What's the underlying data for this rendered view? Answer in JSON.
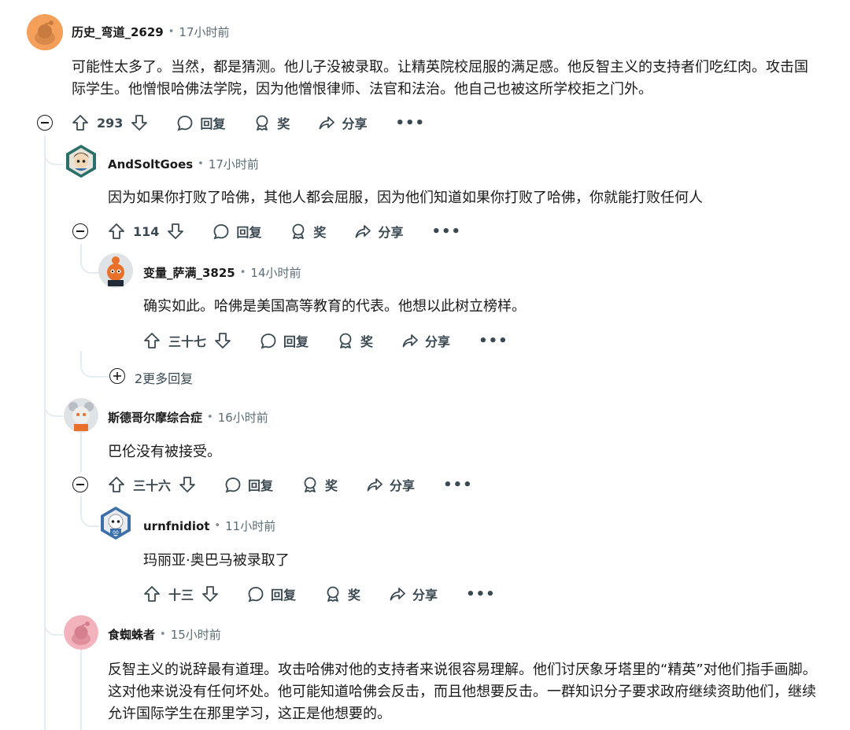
{
  "comments": [
    {
      "username": "历史_弯道_2629",
      "time": "17小时前",
      "text": "可能性太多了。当然，都是猜测。他儿子没被录取。让精英院校屈服的满足感。他反智主义的支持者们吃红肉。攻击国际学生。他憎恨哈佛法学院，因为他憎恨律师、法官和法治。他自己也被这所学校拒之门外。",
      "votes": "293"
    },
    {
      "username": "AndSoltGoes",
      "time": "17小时前",
      "text": "因为如果你打败了哈佛，其他人都会屈服，因为他们知道如果你打败了哈佛，你就能打败任何人",
      "votes": "114"
    },
    {
      "username": "变量_萨满_3825",
      "time": "14小时前",
      "text": "确实如此。哈佛是美国高等教育的代表。他想以此树立榜样。",
      "votes": "三十七"
    },
    {
      "username": "斯德哥尔摩综合症",
      "time": "16小时前",
      "text": "巴伦没有被接受。",
      "votes": "三十六"
    },
    {
      "username": "urnfnidiot",
      "time": "11小时前",
      "text": "玛丽亚·奥巴马被录取了",
      "votes": "十三"
    },
    {
      "username": "食蜘蛛者",
      "time": "15小时前",
      "text": "反智主义的说辞最有道理。攻击哈佛对他的支持者来说很容易理解。他们讨厌象牙塔里的“精英”对他们指手画脚。这对他来说没有任何坏处。他可能知道哈佛会反击，而且他想要反击。一群知识分子要求政府继续资助他们，继续允许国际学生在那里学习，这正是他想要的。"
    }
  ],
  "actions": {
    "reply": "回复",
    "award": "奖",
    "share": "分享",
    "more": "•••"
  },
  "more_replies": "2更多回复",
  "colors": {
    "thread_line": "#e5ebee",
    "meta_text": "#5c6c74",
    "action_text": "#3b4a52"
  }
}
